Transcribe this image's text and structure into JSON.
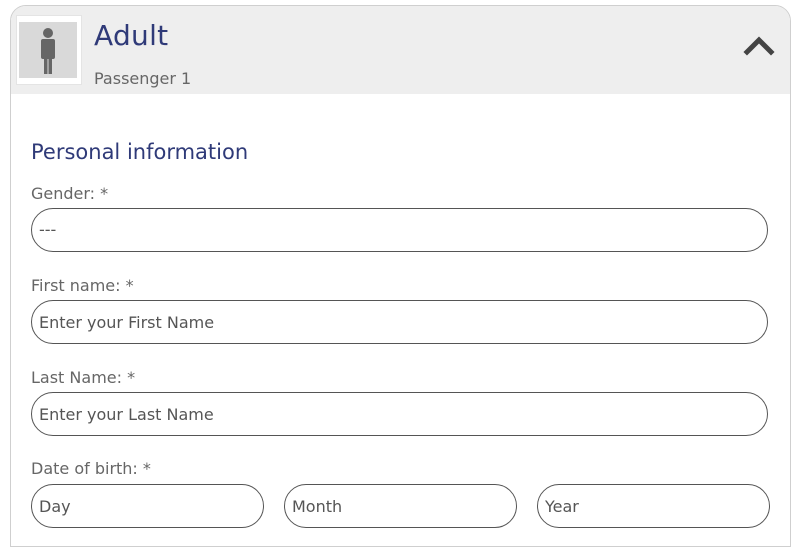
{
  "passenger": {
    "type": "Adult",
    "label": "Passenger 1",
    "avatar_icon": "person-icon",
    "collapse_icon": "chevron-up-icon"
  },
  "form": {
    "section_title": "Personal information",
    "gender": {
      "label": "Gender: *",
      "value": "---"
    },
    "first_name": {
      "label": "First name: *",
      "placeholder": "Enter your First Name"
    },
    "last_name": {
      "label": "Last Name: *",
      "placeholder": "Enter your Last Name"
    },
    "dob": {
      "label": "Date of birth: *",
      "day_placeholder": "Day",
      "month_placeholder": "Month",
      "year_placeholder": "Year"
    }
  },
  "colors": {
    "accent": "#2f3a78",
    "header_bg": "#eeeeee",
    "label_text": "#666666"
  }
}
